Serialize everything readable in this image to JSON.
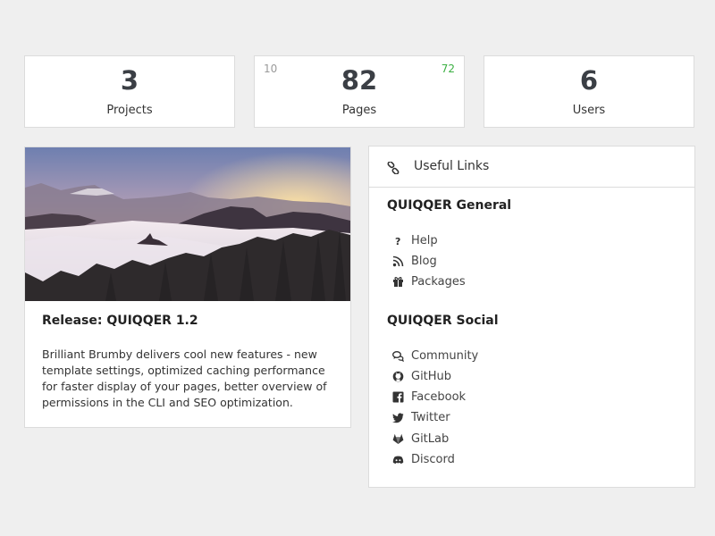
{
  "stats": {
    "projects": {
      "value": "3",
      "label": "Projects"
    },
    "pages": {
      "value": "82",
      "label": "Pages",
      "left_count": "10",
      "right_count": "72"
    },
    "users": {
      "value": "6",
      "label": "Users"
    }
  },
  "release": {
    "title": "Release: QUIQQER 1.2",
    "text": "Brilliant Brumby delivers cool new features - new template settings, optimized caching performance for faster display of your pages, better overview of permissions in the CLI and SEO optimization."
  },
  "links": {
    "title": "Useful Links",
    "general": {
      "title": "QUIQQER General",
      "items": [
        {
          "label": "Help",
          "icon": "question-icon"
        },
        {
          "label": "Blog",
          "icon": "rss-icon"
        },
        {
          "label": "Packages",
          "icon": "gift-icon"
        }
      ]
    },
    "social": {
      "title": "QUIQQER Social",
      "items": [
        {
          "label": "Community",
          "icon": "comments-icon"
        },
        {
          "label": "GitHub",
          "icon": "github-icon"
        },
        {
          "label": "Facebook",
          "icon": "facebook-icon"
        },
        {
          "label": "Twitter",
          "icon": "twitter-icon"
        },
        {
          "label": "GitLab",
          "icon": "gitlab-icon"
        },
        {
          "label": "Discord",
          "icon": "discord-icon"
        }
      ]
    }
  },
  "colors": {
    "background": "#efefef",
    "card": "#ffffff",
    "border": "#dcdcdc",
    "stat_number": "#3b3f45",
    "positive": "#3cb043",
    "muted": "#9a9a9a"
  }
}
